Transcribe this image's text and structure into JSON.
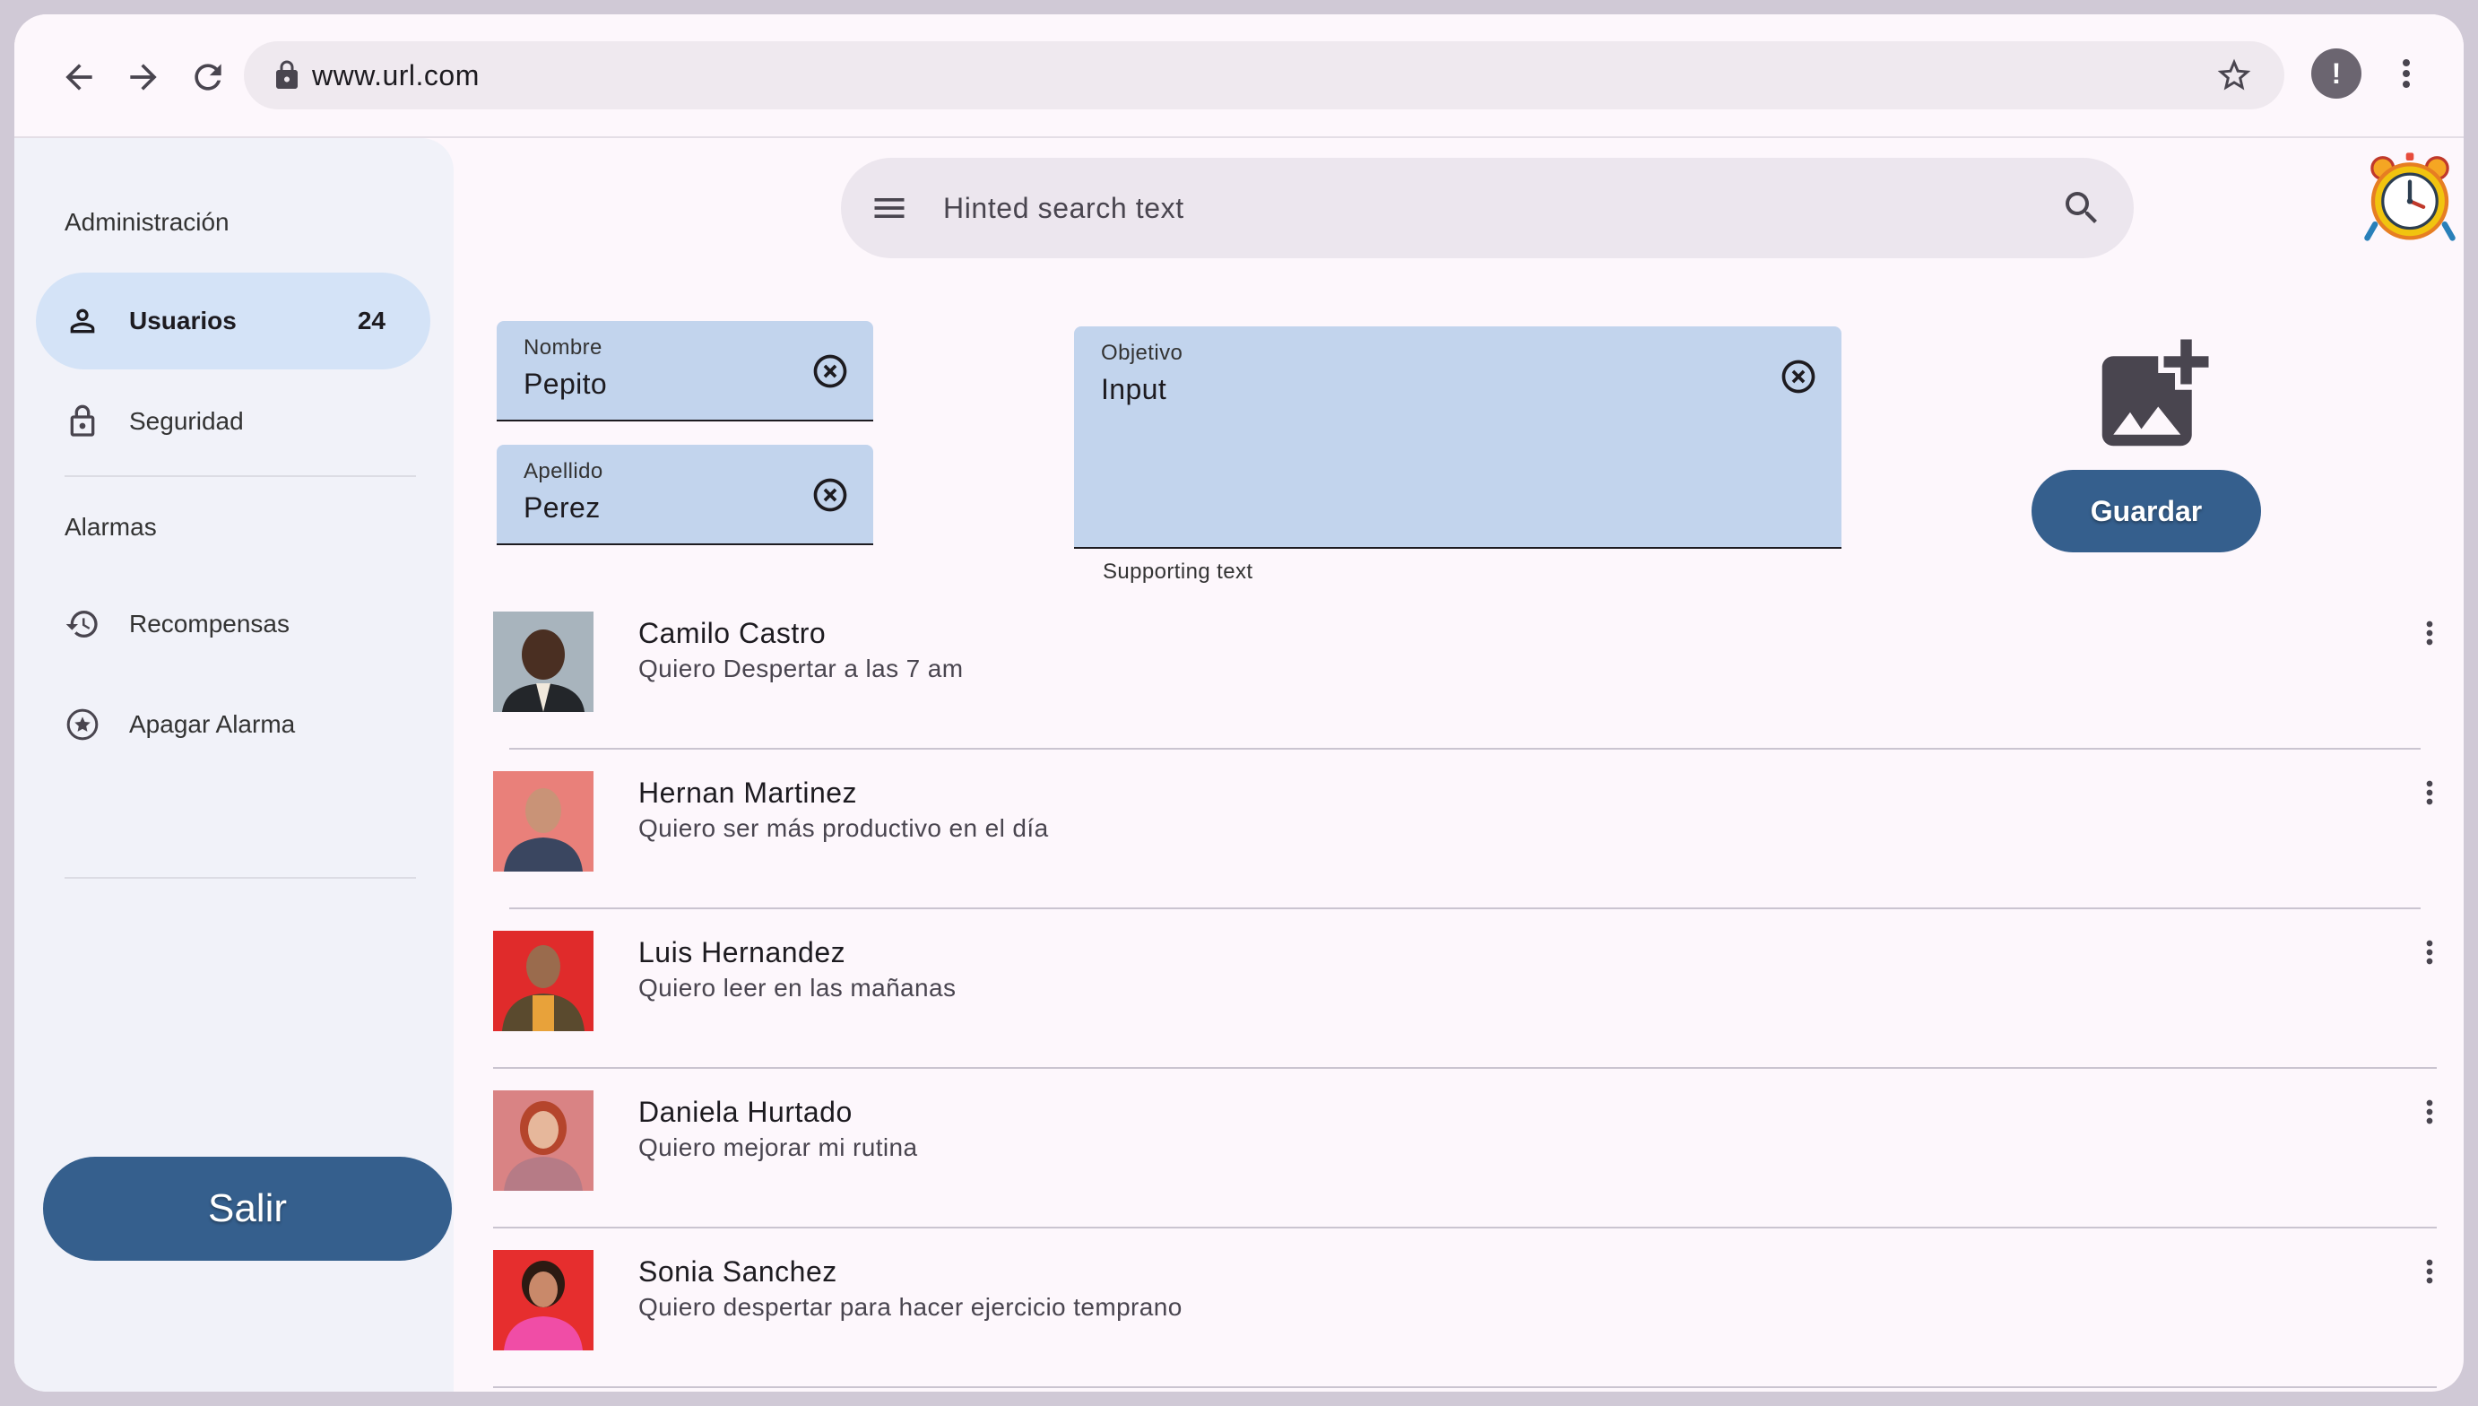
{
  "browser": {
    "url": "www.url.com",
    "profile_initial": "!"
  },
  "sidebar": {
    "section_admin": "Administración",
    "items": [
      {
        "label": "Usuarios",
        "badge": "24",
        "icon": "person-icon",
        "active": true
      },
      {
        "label": "Seguridad",
        "icon": "lock-icon"
      }
    ],
    "section_alarms": "Alarmas",
    "alarm_items": [
      {
        "label": "Recompensas",
        "icon": "history-icon"
      },
      {
        "label": "Apagar Alarma",
        "icon": "star-circle-icon"
      }
    ],
    "logout_label": "Salir"
  },
  "search": {
    "placeholder": "Hinted search text"
  },
  "form": {
    "nombre_label": "Nombre",
    "nombre_value": "Pepito",
    "apellido_label": "Apellido",
    "apellido_value": "Perez",
    "objetivo_label": "Objetivo",
    "objetivo_value": "Input",
    "objetivo_support": "Supporting text",
    "save_label": "Guardar"
  },
  "users": [
    {
      "name": "Camilo Castro",
      "goal": "Quiero Despertar a las 7 am"
    },
    {
      "name": "Hernan Martinez",
      "goal": "Quiero ser más productivo en el día"
    },
    {
      "name": "Luis Hernandez",
      "goal": "Quiero leer en las mañanas"
    },
    {
      "name": "Daniela Hurtado",
      "goal": "Quiero mejorar mi rutina"
    },
    {
      "name": "Sonia Sanchez",
      "goal": "Quiero despertar para hacer ejercicio temprano"
    }
  ],
  "colors": {
    "primary": "#355f8d",
    "field_fill": "#c2d4ed",
    "active_nav": "#d4e3f7",
    "background": "#fdf7fc"
  }
}
